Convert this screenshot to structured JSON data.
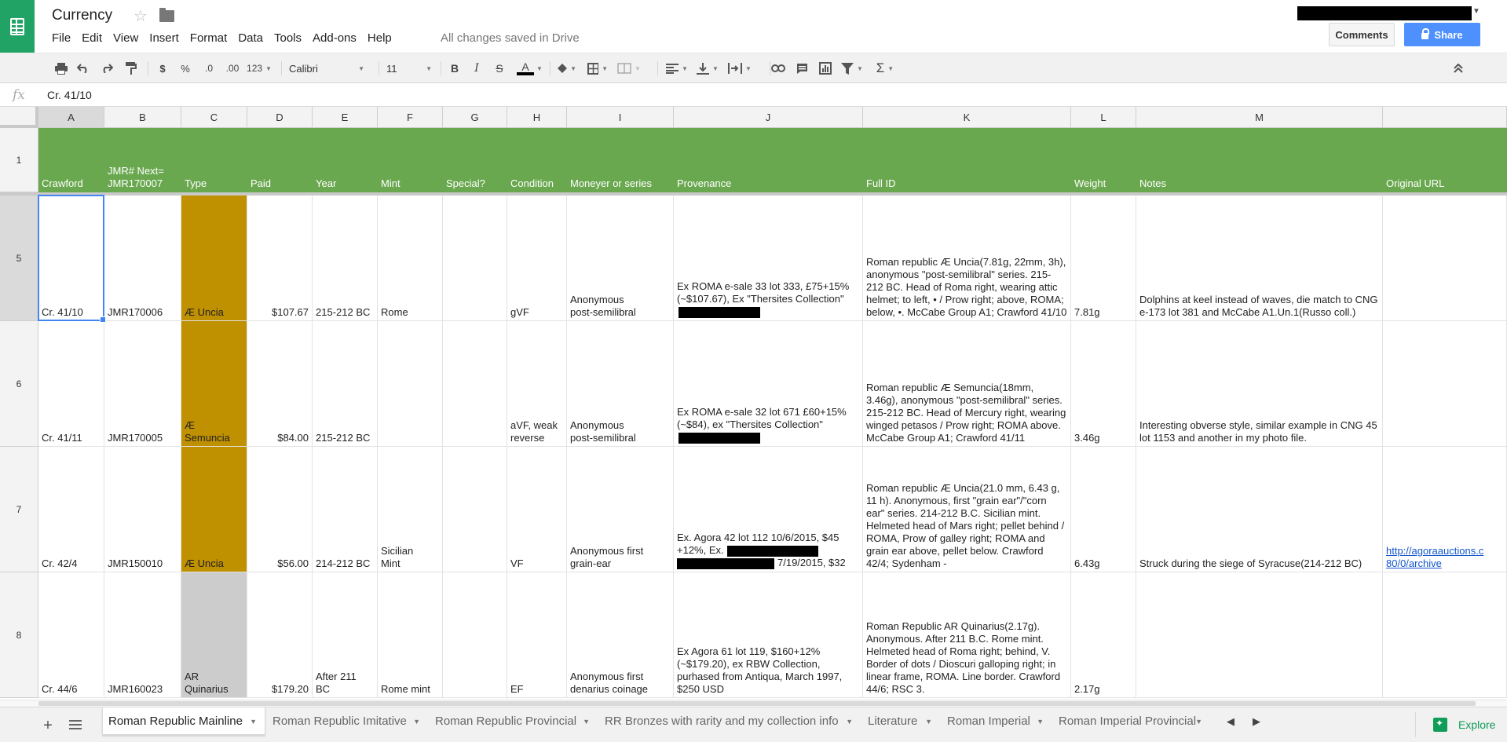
{
  "title": {
    "doc_name": "Currency",
    "save_status": "All changes saved in Drive",
    "comments_label": "Comments",
    "share_label": "Share"
  },
  "menu": [
    "File",
    "Edit",
    "View",
    "Insert",
    "Format",
    "Data",
    "Tools",
    "Add-ons",
    "Help"
  ],
  "toolbar": {
    "currency": "$",
    "percent": "%",
    "dec_less": ".0",
    "dec_more": ".00",
    "more_formats": "123",
    "font": "Calibri",
    "font_size": "11",
    "bold": "B",
    "italic": "I",
    "strike": "S",
    "text_color": "A"
  },
  "formula_bar": {
    "fx": "fx",
    "value": "Cr. 41/10"
  },
  "grid": {
    "selected_col": "A",
    "selected_row": "5",
    "columns": [
      {
        "letter": "A",
        "header": "Crawford"
      },
      {
        "letter": "B",
        "header": "JMR# Next=\nJMR170007"
      },
      {
        "letter": "C",
        "header": "Type"
      },
      {
        "letter": "D",
        "header": "Paid"
      },
      {
        "letter": "E",
        "header": "Year"
      },
      {
        "letter": "F",
        "header": "Mint"
      },
      {
        "letter": "G",
        "header": "Special?"
      },
      {
        "letter": "H",
        "header": "Condition"
      },
      {
        "letter": "I",
        "header": "Moneyer or series"
      },
      {
        "letter": "J",
        "header": "Provenance"
      },
      {
        "letter": "K",
        "header": "Full ID"
      },
      {
        "letter": "L",
        "header": "Weight"
      },
      {
        "letter": "M",
        "header": "Notes"
      },
      {
        "letter": "",
        "header": "Original URL"
      }
    ],
    "header_row_number": "1",
    "rows": [
      {
        "num": "5",
        "crawford": "Cr. 41/10",
        "jmr": "JMR170006",
        "type": "Æ Uncia",
        "type_color": "gold",
        "paid": "$107.67",
        "year": "215-212 BC",
        "mint": "Rome",
        "special": "",
        "condition": "gVF",
        "moneyer": "Anonymous\npost-semilibral",
        "provenance": "Ex ROMA e-sale 33 lot 333, £75+15%(~$107.67), Ex \"Thersites Collection\"",
        "full_id": "Roman republic Æ Uncia(7.81g, 22mm, 3h), anonymous \"post-semilibral\" series. 215-212 BC. Head of Roma right, wearing attic helmet; to left, • / Prow right; above, ROMA; below, •. McCabe Group A1; Crawford 41/10",
        "weight": "7.81g",
        "notes": "Dolphins at keel instead of waves, die match to CNG e-173 lot 381 and McCabe A1.Un.1(Russo coll.)",
        "url": "",
        "url_line2": ""
      },
      {
        "num": "6",
        "crawford": "Cr. 41/11",
        "jmr": "JMR170005",
        "type": "Æ\nSemuncia",
        "type_color": "gold",
        "paid": "$84.00",
        "year": "215-212 BC",
        "mint": "",
        "special": "",
        "condition": "aVF, weak\nreverse",
        "moneyer": "Anonymous\npost-semilibral",
        "provenance": "Ex ROMA e-sale 32 lot 671 £60+15%(~$84), ex \"Thersites Collection\"",
        "full_id": "Roman republic Æ Semuncia(18mm, 3.46g), anonymous \"post-semilibral\" series. 215-212 BC. Head of Mercury right, wearing winged petasos / Prow right; ROMA above. McCabe Group A1; Crawford 41/11",
        "weight": "3.46g",
        "notes": "Interesting obverse style, similar example in CNG 45 lot 1153 and another in my photo file.",
        "url": "",
        "url_line2": ""
      },
      {
        "num": "7",
        "crawford": "Cr. 42/4",
        "jmr": "JMR150010",
        "type": "Æ Uncia",
        "type_color": "gold",
        "paid": "$56.00",
        "year": "214-212 BC",
        "mint": "Sicilian\nMint",
        "special": "",
        "condition": "VF",
        "moneyer": "Anonymous first\ngrain-ear",
        "provenance": "Ex. Agora 42 lot 112 10/6/2015, $45 +12%, Ex.",
        "provenance_tail": "7/19/2015, $32",
        "full_id": "Roman republic Æ Uncia(21.0 mm, 6.43 g, 11 h). Anonymous, first \"grain ear\"/\"corn ear\" series. 214-212 B.C. Sicilian mint. Helmeted head of Mars right; pellet behind / ROMA, Prow of galley right; ROMA and grain ear above, pellet below. Crawford 42/4; Sydenham -",
        "weight": "6.43g",
        "notes": "Struck during the siege of Syracuse(214-212 BC)",
        "url": "http://agoraauctions.c",
        "url_line2": "80/0/archive"
      },
      {
        "num": "8",
        "crawford": "Cr. 44/6",
        "jmr": "JMR160023",
        "type": "AR\nQuinarius",
        "type_color": "grey",
        "paid": "$179.20",
        "year": "After 211\nBC",
        "mint": "Rome mint",
        "special": "",
        "condition": "EF",
        "moneyer": "Anonymous first\ndenarius coinage",
        "provenance": "Ex Agora 61 lot 119, $160+12%(~$179.20), ex RBW Collection, purhased from Antiqua, March 1997, $250 USD",
        "full_id": "Roman Republic AR Quinarius(2.17g). Anonymous. After 211 B.C. Rome mint. Helmeted head of Roma right; behind, V. Border of dots / Dioscuri galloping right; in linear frame, ROMA. Line border. Crawford 44/6; RSC 3.",
        "weight": "2.17g",
        "notes": "",
        "url": "",
        "url_line2": ""
      }
    ]
  },
  "sheets": [
    {
      "name": "Roman Republic Mainline",
      "active": true
    },
    {
      "name": "Roman Republic Imitative",
      "active": false
    },
    {
      "name": "Roman Republic Provincial",
      "active": false
    },
    {
      "name": "RR Bronzes with rarity and my collection info",
      "active": false
    },
    {
      "name": "Literature",
      "active": false
    },
    {
      "name": "Roman Imperial",
      "active": false
    },
    {
      "name": "Roman Imperial Provincial",
      "active": false
    }
  ],
  "explore_label": "Explore",
  "colors": {
    "app_green": "#21a366",
    "header_green": "#6aa84f",
    "type_gold": "#bf9000",
    "type_grey": "#cccccc",
    "share_blue": "#4d90fe",
    "link_blue": "#1155cc",
    "selection_blue": "#4285f4"
  }
}
